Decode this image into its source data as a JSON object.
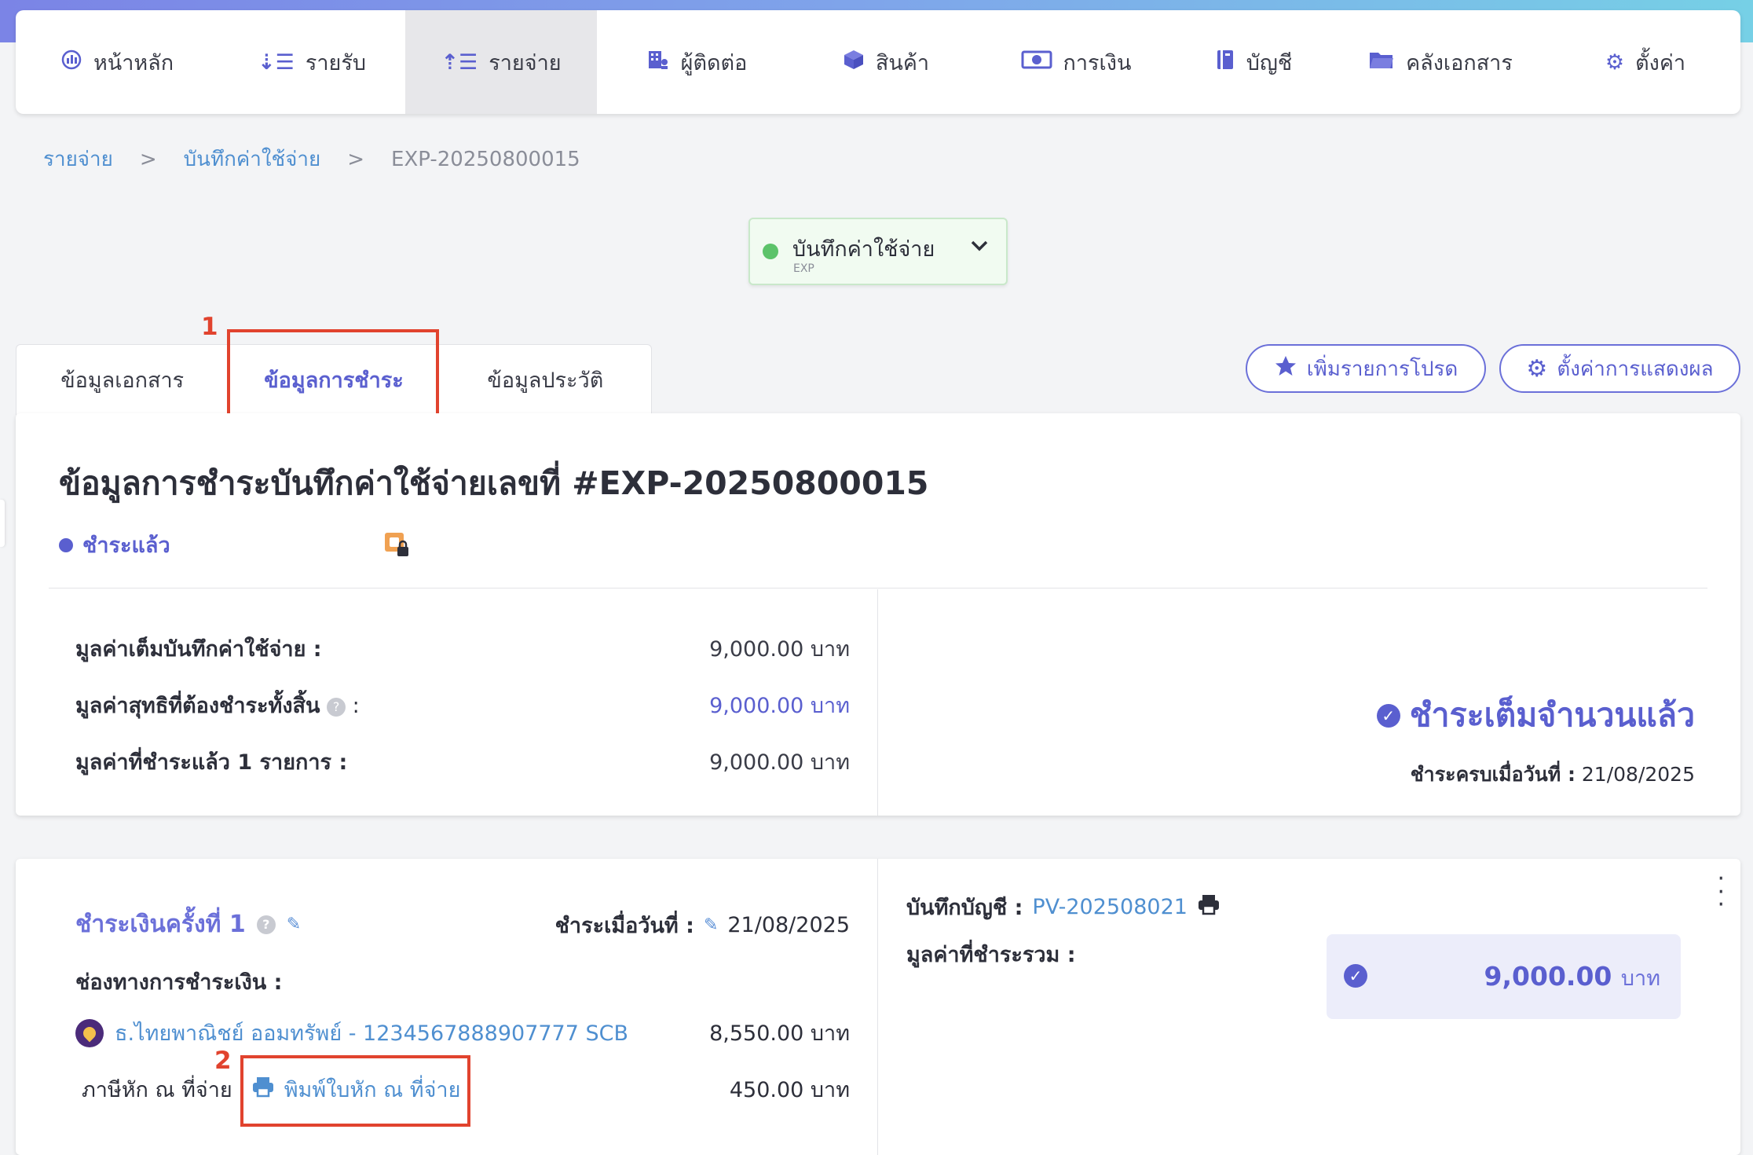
{
  "nav": {
    "items": [
      {
        "label": "หน้าหลัก",
        "icon": "dashboard-icon"
      },
      {
        "label": "รายรับ",
        "icon": "income-list-icon"
      },
      {
        "label": "รายจ่าย",
        "icon": "expense-list-icon"
      },
      {
        "label": "ผู้ติดต่อ",
        "icon": "contacts-icon"
      },
      {
        "label": "สินค้า",
        "icon": "box-icon"
      },
      {
        "label": "การเงิน",
        "icon": "money-icon"
      },
      {
        "label": "บัญชี",
        "icon": "ledger-icon"
      },
      {
        "label": "คลังเอกสาร",
        "icon": "folder-icon"
      },
      {
        "label": "ตั้งค่า",
        "icon": "gear-icon"
      }
    ],
    "active": "รายจ่าย"
  },
  "breadcrumb": {
    "items": [
      "รายจ่าย",
      "บันทึกค่าใช้จ่าย"
    ],
    "current": "EXP-20250800015",
    "separator": ">"
  },
  "doc_type": {
    "label": "บันทึกค่าใช้จ่าย",
    "sub": "EXP"
  },
  "tabs": {
    "items": [
      "ข้อมูลเอกสาร",
      "ข้อมูลการชำระ",
      "ข้อมูลประวัติ"
    ],
    "active": "ข้อมูลการชำระ"
  },
  "annotations": {
    "one": "1",
    "two": "2"
  },
  "actions": {
    "favorite": "เพิ่มรายการโปรด",
    "display_settings": "ตั้งค่าการแสดงผล"
  },
  "summary": {
    "title": "ข้อมูลการชำระบันทึกค่าใช้จ่ายเลขที่ #EXP-20250800015",
    "status": "ชำระแล้ว",
    "rows": [
      {
        "label": "มูลค่าเต็มบันทึกค่าใช้จ่าย :",
        "value": "9,000.00 บาท"
      },
      {
        "label": "มูลค่าสุทธิที่ต้องชำระทั้งสิ้น",
        "suffix": ":",
        "value": "9,000.00 บาท"
      },
      {
        "label": "มูลค่าที่ชำระแล้ว 1 รายการ :",
        "value": "9,000.00 บาท"
      }
    ],
    "fully_paid": "ชำระเต็มจำนวนแล้ว",
    "paid_date_label": "ชำระครบเมื่อวันที่ :",
    "paid_date": "21/08/2025"
  },
  "payment": {
    "title": "ชำระเงินครั้งที่ 1",
    "date_label": "ชำระเมื่อวันที่ :",
    "date": "21/08/2025",
    "channel_label": "ช่องทางการชำระเงิน :",
    "bank": "ธ.ไทยพาณิชย์ ออมทรัพย์ - 1234567888907777 SCB",
    "bank_amount": "8,550.00 บาท",
    "wht_label": "ภาษีหัก ณ ที่จ่าย",
    "wht_print": "พิมพ์ใบหัก ณ ที่จ่าย",
    "wht_amount": "450.00 บาท",
    "account_label": "บันทึกบัญชี :",
    "account_no": "PV-202508021",
    "total_label": "มูลค่าที่ชำระรวม :",
    "total_value": "9,000.00",
    "total_unit": "บาท"
  },
  "colors": {
    "accent": "#5a5fcf",
    "link": "#4f8fd0",
    "highlight": "#e1432e",
    "success": "#5cc36a"
  }
}
